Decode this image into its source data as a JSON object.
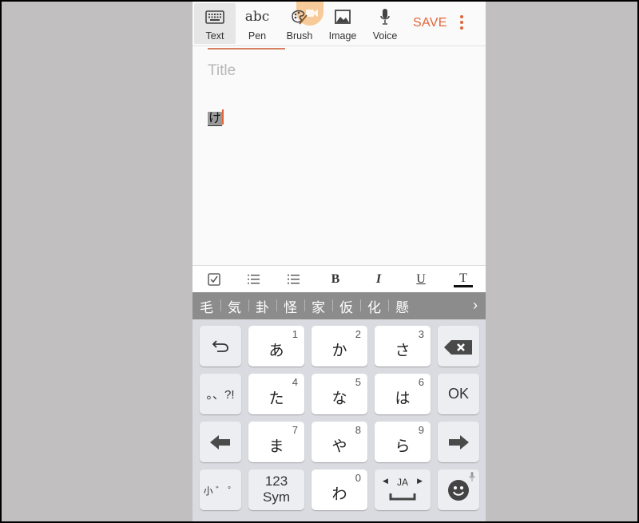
{
  "toolbar": {
    "tools": [
      {
        "label": "Text",
        "icon": "keyboard-icon",
        "active": true
      },
      {
        "label": "Pen",
        "icon": "abc-handwriting-icon",
        "glyph": "abc"
      },
      {
        "label": "Brush",
        "icon": "palette-icon"
      },
      {
        "label": "Image",
        "icon": "image-icon"
      },
      {
        "label": "Voice",
        "icon": "microphone-icon"
      }
    ],
    "save_label": "SAVE",
    "more_icon": "more-vertical-icon",
    "recording_badge_icon": "video-camera-icon"
  },
  "editor": {
    "title_placeholder": "Title",
    "body_composing_text": "け"
  },
  "format_bar": {
    "items": [
      {
        "name": "checkbox",
        "icon": "checkbox-icon"
      },
      {
        "name": "numbered-list",
        "icon": "numbered-list-icon"
      },
      {
        "name": "bulleted-list",
        "icon": "bulleted-list-icon"
      },
      {
        "name": "bold",
        "label": "B"
      },
      {
        "name": "italic",
        "label": "I"
      },
      {
        "name": "underline",
        "label": "U"
      },
      {
        "name": "text-color",
        "label": "T"
      }
    ]
  },
  "candidates": {
    "items": [
      "毛",
      "気",
      "卦",
      "怪",
      "家",
      "仮",
      "化",
      "懸"
    ],
    "more_icon": "chevron-right-icon",
    "more_glyph": "›"
  },
  "keyboard": {
    "rows": [
      [
        {
          "type": "fn",
          "name": "undo",
          "icon": "undo-icon"
        },
        {
          "type": "char",
          "label": "あ",
          "num": "1"
        },
        {
          "type": "char",
          "label": "か",
          "num": "2"
        },
        {
          "type": "char",
          "label": "さ",
          "num": "3"
        },
        {
          "type": "fn",
          "name": "backspace",
          "icon": "backspace-icon"
        }
      ],
      [
        {
          "type": "fn",
          "name": "punctuation",
          "label": "。、?!"
        },
        {
          "type": "char",
          "label": "た",
          "num": "4"
        },
        {
          "type": "char",
          "label": "な",
          "num": "5"
        },
        {
          "type": "char",
          "label": "は",
          "num": "6"
        },
        {
          "type": "fn",
          "name": "ok",
          "label": "OK"
        }
      ],
      [
        {
          "type": "fn",
          "name": "cursor-left",
          "icon": "arrow-left-icon"
        },
        {
          "type": "char",
          "label": "ま",
          "num": "7"
        },
        {
          "type": "char",
          "label": "や",
          "num": "8"
        },
        {
          "type": "char",
          "label": "ら",
          "num": "9"
        },
        {
          "type": "fn",
          "name": "cursor-right",
          "icon": "arrow-right-icon"
        }
      ],
      [
        {
          "type": "fn",
          "name": "small-dakuten",
          "label": "小 ゛ ゜"
        },
        {
          "type": "fn2",
          "name": "symbols",
          "label1": "123",
          "label2": "Sym"
        },
        {
          "type": "char",
          "label": "わ",
          "num": "0"
        },
        {
          "type": "fn2",
          "name": "space-language",
          "label": "JA",
          "icon": "space-bar-icon"
        },
        {
          "type": "fn",
          "name": "emoji",
          "icon": "emoji-icon",
          "secondary_icon": "microphone-icon"
        }
      ]
    ]
  },
  "colors": {
    "accent": "#e0663a",
    "backdrop": "#c2bfc0",
    "candidate_bar": "#8c8c8c",
    "keyboard_bg": "#d9dbe0"
  }
}
